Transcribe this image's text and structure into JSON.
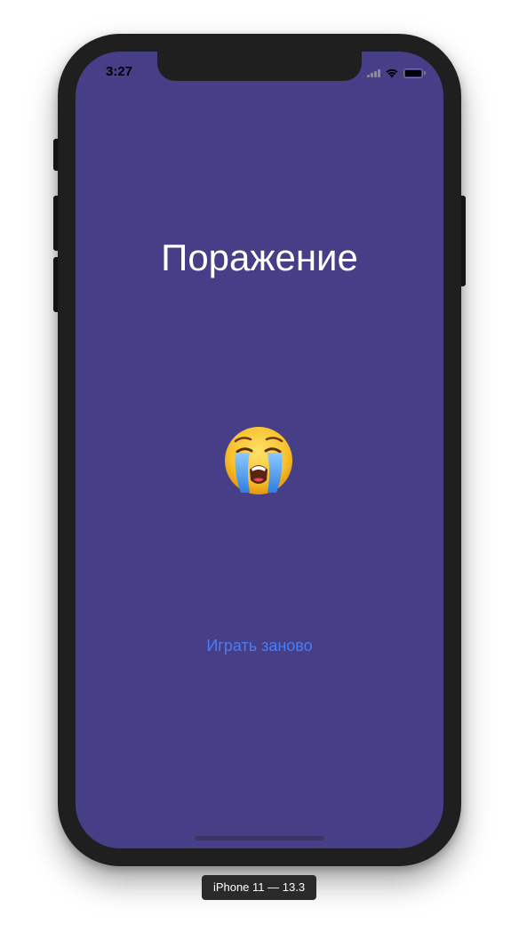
{
  "status_bar": {
    "time": "3:27"
  },
  "screen": {
    "title": "Поражение",
    "emoji_icon": "loudly-crying-face",
    "replay_label": "Играть заново"
  },
  "simulator": {
    "device_label": "iPhone 11 — 13.3"
  },
  "colors": {
    "screen_background": "#463f87",
    "title_text": "#ffffff",
    "link_text": "#4a7cf6",
    "device_frame": "#1f1f1f",
    "home_indicator": "#3a3566"
  }
}
